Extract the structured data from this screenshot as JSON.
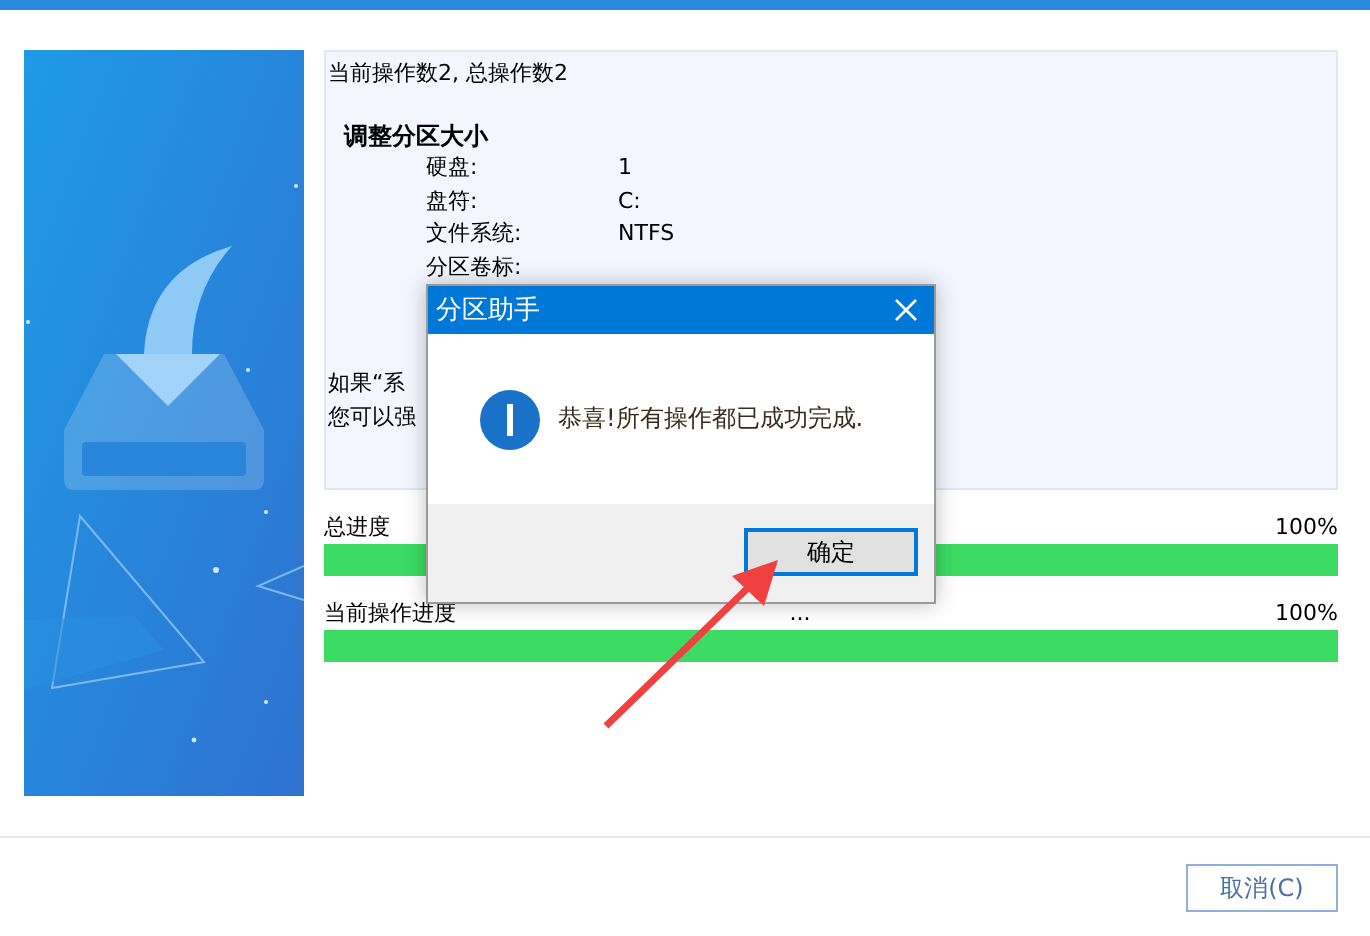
{
  "log": {
    "summary": "当前操作数2,  总操作数2",
    "operation_title": "调整分区大小",
    "fields": [
      {
        "label": "硬盘:",
        "value": "1"
      },
      {
        "label": "盘符:",
        "value": "C:"
      },
      {
        "label": "文件系统:",
        "value": "NTFS"
      },
      {
        "label": "分区卷标:"
      }
    ],
    "notes": [
      "如果“系",
      "您可以强"
    ]
  },
  "progress": [
    {
      "label": "总进度",
      "reading": "100%",
      "level": 1
    },
    {
      "label": "当前操作进度",
      "detail": "...",
      "reading": "100%",
      "level": 1
    }
  ],
  "dialog": {
    "title": "分区助手",
    "message": "恭喜!所有操作都已成功完成.",
    "ok_button": "确定"
  },
  "cancel_button": "取消(C)"
}
